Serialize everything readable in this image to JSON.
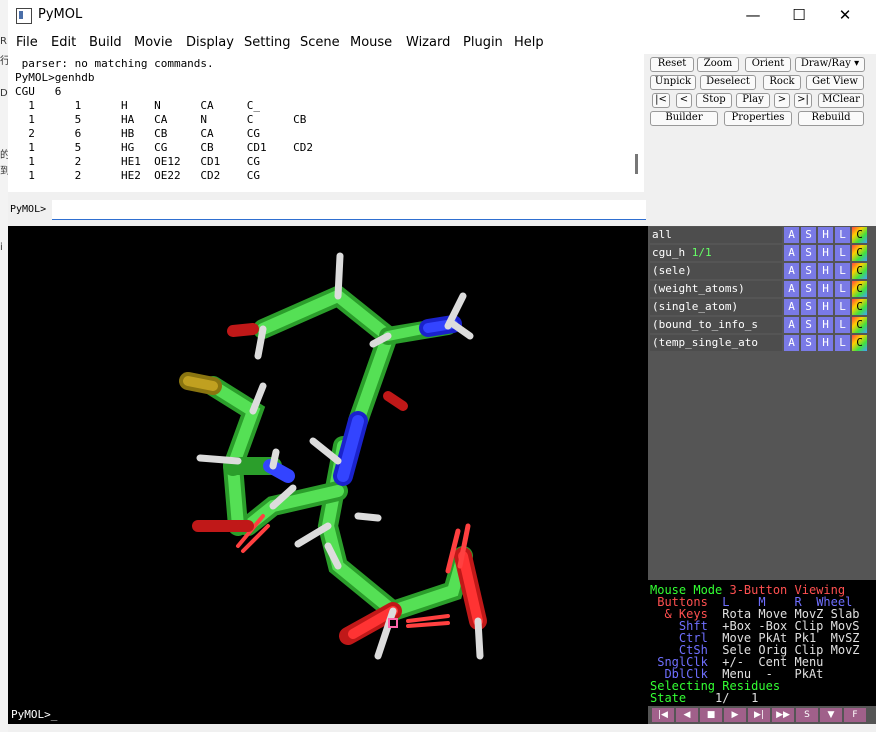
{
  "window": {
    "title": "PyMOL",
    "minimize": "—",
    "maximize": "☐",
    "close": "✕"
  },
  "menu": [
    "File",
    "Edit",
    "Build",
    "Movie",
    "Display",
    "Setting",
    "Scene",
    "Mouse",
    "Wizard",
    "Plugin",
    "Help"
  ],
  "output_lines": [
    " parser: no matching commands.",
    "PyMOL>genhdb",
    "CGU   6",
    "  1      1      H    N      CA     C_",
    "  1      5      HA   CA     N      C      CB",
    "  2      6      HB   CB     CA     CG",
    "  1      5      HG   CG     CB     CD1    CD2",
    "  1      2      HE1  OE12   CD1    CG",
    "  1      2      HE2  OE22   CD2    CG"
  ],
  "command": {
    "label": "PyMOL>",
    "value": ""
  },
  "buttons": {
    "row1": [
      "Reset",
      "Zoom",
      "Orient",
      "Draw/Ray ▾"
    ],
    "row2": [
      "Unpick",
      "Deselect",
      "Rock",
      "Get View"
    ],
    "row3": [
      "|<",
      "<",
      "Stop",
      "Play",
      ">",
      ">|",
      "MClear"
    ],
    "row4": [
      "Builder",
      "Properties",
      "Rebuild"
    ]
  },
  "objects": [
    {
      "name": "all",
      "count": ""
    },
    {
      "name": "cgu_h",
      "count": "1/1"
    },
    {
      "name": "(sele)",
      "count": ""
    },
    {
      "name": "(weight_atoms)",
      "count": ""
    },
    {
      "name": "(single_atom)",
      "count": ""
    },
    {
      "name": "(bound_to_info_s",
      "count": ""
    },
    {
      "name": "(temp_single_ato",
      "count": ""
    }
  ],
  "obj_buttons": [
    "A",
    "S",
    "H",
    "L",
    "C"
  ],
  "mouse_mode": {
    "line1a": "Mouse Mode ",
    "line1b": "3-Button Viewing",
    "line2": [
      " Buttons  ",
      "L    ",
      "M    ",
      "R  ",
      "Wheel"
    ],
    "line3": [
      "  & Keys  ",
      "Rota Move MovZ Slab"
    ],
    "line4": [
      "    Shft  ",
      "+Box -Box Clip MovS"
    ],
    "line5": [
      "    Ctrl  ",
      "Move PkAt Pk1  MvSZ"
    ],
    "line6": [
      "    CtSh  ",
      "Sele Orig Clip MovZ"
    ],
    "line7": [
      " SnglClk  ",
      "+/-  Cent Menu"
    ],
    "line8": [
      "  DblClk  ",
      "Menu  -   PkAt"
    ],
    "line9": "Selecting Residues",
    "line10a": "State ",
    "line10b": "   1/   1"
  },
  "playback": [
    "|◀",
    "◀",
    "■",
    "▶",
    "▶|",
    "▶▶",
    "S",
    "▼",
    "F"
  ],
  "bottom_prompt": "PyMOL>_",
  "colors": {
    "carbon": "#33cc33",
    "nitrogen": "#2233ff",
    "oxygen": "#ff2d2d",
    "hydrogen": "#e6e6e6",
    "sulfur": "#b8a018"
  }
}
